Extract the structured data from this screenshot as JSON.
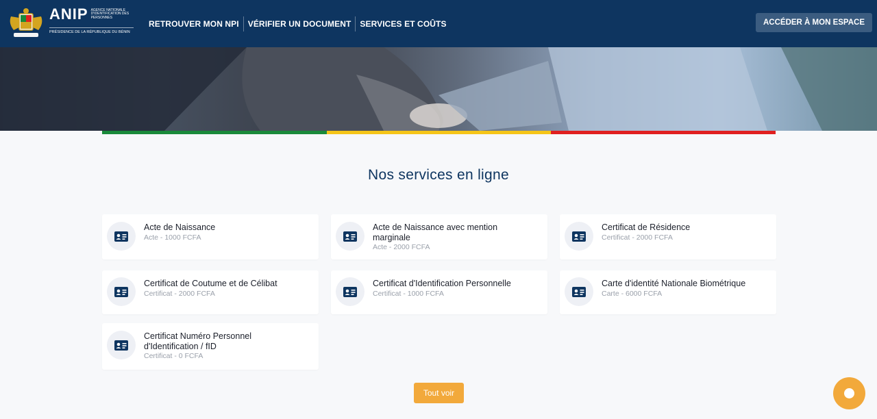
{
  "header": {
    "logo": {
      "acronym": "ANIP",
      "agency": "Agence Nationale d'Identification des Personnes",
      "presidency": "Présidence de la République du Bénin"
    },
    "nav": [
      "RETROUVER MON NPI",
      "VÉRIFIER UN DOCUMENT",
      "SERVICES ET COÛTS"
    ],
    "cta_label": "ACCÉDER À MON ESPACE"
  },
  "flag_colors": [
    "#1a8a3a",
    "#f5c518",
    "#e02020"
  ],
  "section": {
    "title": "Nos services en ligne"
  },
  "services": [
    {
      "title": "Acte de Naissance",
      "subtitle": "Acte - 1000 FCFA",
      "icon": "id-card-icon"
    },
    {
      "title": "Acte de Naissance avec mention marginale",
      "subtitle": "Acte - 2000 FCFA",
      "icon": "id-card-icon"
    },
    {
      "title": "Certificat de Résidence",
      "subtitle": "Certificat - 2000 FCFA",
      "icon": "id-card-icon"
    },
    {
      "title": "Certificat de Coutume et de Célibat",
      "subtitle": "Certificat - 2000 FCFA",
      "icon": "id-card-icon"
    },
    {
      "title": "Certificat d'Identification Personnelle",
      "subtitle": "Certificat - 1000 FCFA",
      "icon": "id-card-icon"
    },
    {
      "title": "Carte d'identité Nationale Biométrique",
      "subtitle": "Carte - 6000 FCFA",
      "icon": "id-card-icon"
    },
    {
      "title": "Certificat Numéro Personnel d'Identification / fID",
      "subtitle": "Certificat - 0 FCFA",
      "icon": "id-card-icon"
    }
  ],
  "see_all_label": "Tout voir",
  "colors": {
    "primary": "#0e3560",
    "accent": "#f2a93b"
  }
}
